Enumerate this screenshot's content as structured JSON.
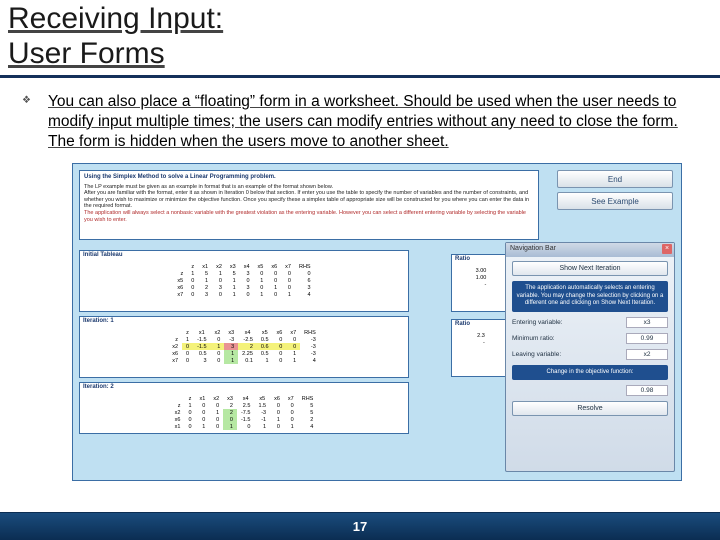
{
  "title_line1": "Receiving Input:",
  "title_line2": "User Forms",
  "bullet": "You can also place a “floating” form in a worksheet.  Should be used when the user needs to modify input multiple times; the users can modify entries without  any need to close the form. The form is hidden when the users move to another sheet.",
  "shot": {
    "header": "Using the Simplex Method to solve a Linear Programming problem.",
    "para1": "The LP example must be given as an example in format that is an example of the format shown below.",
    "para2": "After you are familiar with the format, enter it as shown in Iteration 0 below that section. If enter you use the table to specify the number of variables and the number of constraints, and whether you wish to maximize or minimize the objective function. Once you specify these a simplex table of appropriate size will be constructed for you where you can enter the data in the required format.",
    "para3": "The application will always select a nonbasic variable with the greatest violation as the entering variable. However you can select a different entering variable by selecting the variable you wish to enter.",
    "btn_end": "End",
    "btn_see": "See Example",
    "tab1_label": "Initial Tableau",
    "tab2_label": "Iteration: 1",
    "tab3_label": "Iteration: 2",
    "cols": [
      "z",
      "x1",
      "x2",
      "x3",
      "x4",
      "x5",
      "x6",
      "x7",
      "RHS"
    ],
    "t1": [
      [
        "z",
        1,
        5,
        1,
        5,
        3,
        0,
        0,
        0,
        0
      ],
      [
        "x5",
        0,
        1,
        0,
        1,
        0,
        1,
        0,
        0,
        6
      ],
      [
        "x6",
        0,
        2,
        3,
        1,
        3,
        0,
        1,
        0,
        3
      ],
      [
        "x7",
        0,
        3,
        0,
        1,
        0,
        1,
        0,
        1,
        4
      ]
    ],
    "ratio1_hdr": "Ratio",
    "ratio1": [
      "3.00",
      "1.00",
      "-"
    ],
    "t2": [
      [
        "z",
        1,
        -1.5,
        0,
        -3,
        -2.5,
        0.5,
        0,
        0,
        -3
      ],
      [
        "x2",
        0,
        -1.5,
        1,
        3,
        2,
        0.6,
        0,
        0,
        -3
      ],
      [
        "x6",
        0,
        0.5,
        0,
        1,
        2.25,
        0.5,
        0,
        1,
        -3
      ],
      [
        "x7",
        0,
        3,
        0,
        1,
        0.1,
        1,
        0,
        1,
        4
      ]
    ],
    "ratio2": [
      "2.3",
      "-"
    ],
    "t3": [
      [
        "z",
        1,
        0,
        0,
        2,
        2.5,
        1.5,
        0,
        0,
        5
      ],
      [
        "x2",
        0,
        0,
        1,
        2,
        -7.5,
        -3,
        0,
        0,
        5
      ],
      [
        "x6",
        0,
        0,
        0,
        0,
        -1.5,
        -1,
        1,
        0,
        2
      ],
      [
        "x1",
        0,
        1,
        0,
        1,
        0,
        1,
        0,
        1,
        4
      ]
    ],
    "nav": {
      "title": "Navigation Bar",
      "show_next": "Show Next Iteration",
      "blurb": "The application automatically selects an entering variable. You may change the selection by clicking on a different one and clicking on Show Next Iteration.",
      "entering_lbl": "Entering variable:",
      "entering_val": "x3",
      "minratio_lbl": "Minimum ratio:",
      "minratio_val": "0.99",
      "leaving_lbl": "Leaving variable:",
      "leaving_val": "x2",
      "change_lbl": "Change in the objective function:",
      "change_val": "0.98",
      "resolve": "Resolve"
    }
  },
  "page_number": "17"
}
